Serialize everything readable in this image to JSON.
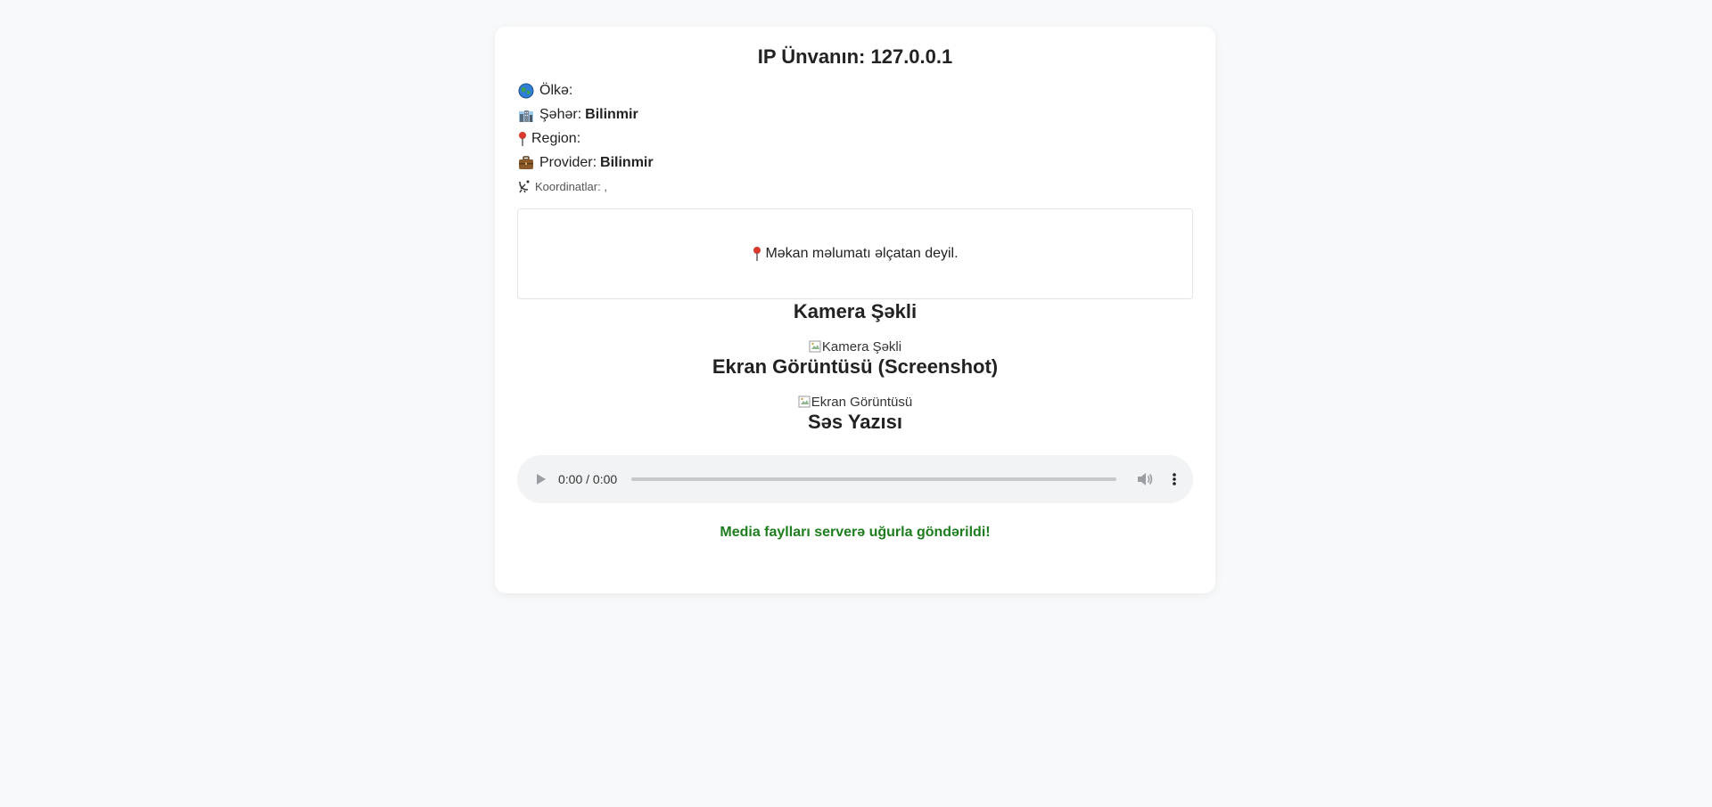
{
  "header": {
    "ip_label": "IP Ünvanın: ",
    "ip_value": "127.0.0.1"
  },
  "info": {
    "country": {
      "icon": "globe-icon",
      "label": "Ölkə:",
      "value": ""
    },
    "city": {
      "icon": "cityscape-icon",
      "label": "Şəhər:",
      "value": "Bilinmir"
    },
    "region": {
      "icon": "pushpin-icon",
      "label": "Region:",
      "value": ""
    },
    "provider": {
      "icon": "briefcase-icon",
      "label": "Provider:",
      "value": "Bilinmir"
    },
    "coordinates": {
      "icon": "satellite-dish-icon",
      "label": "Koordinatlar: ,",
      "value": ""
    }
  },
  "map": {
    "icon": "pushpin-icon",
    "message": "Məkan məlumatı əlçatan deyil."
  },
  "camera": {
    "title": "Kamera Şəkli",
    "image_alt": "Kamera Şəkli"
  },
  "screenshot": {
    "title": "Ekran Görüntüsü (Screenshot)",
    "image_alt": "Ekran Görüntüsü"
  },
  "audio": {
    "title": "Səs Yazısı",
    "time": "0:00 / 0:00",
    "progress": 0
  },
  "status": {
    "message": "Media faylları serverə uğurla göndərildi!",
    "color": "#1e7d1e"
  },
  "colors": {
    "background": "#f8f9fa",
    "card": "#ffffff",
    "player": "#f1f3f4"
  }
}
